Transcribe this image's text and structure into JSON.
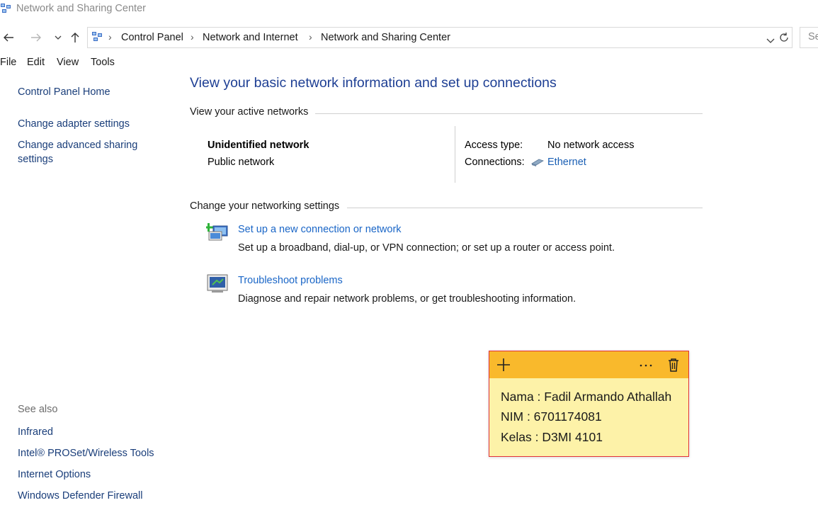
{
  "window": {
    "title": "Network and Sharing Center"
  },
  "nav": {
    "breadcrumb": [
      "Control Panel",
      "Network and Internet",
      "Network and Sharing Center"
    ],
    "search_placeholder": "Se"
  },
  "menu": [
    "File",
    "Edit",
    "View",
    "Tools"
  ],
  "sidebar": {
    "home": "Control Panel Home",
    "links": [
      "Change adapter settings",
      "Change advanced sharing",
      "settings"
    ],
    "see_also_label": "See also",
    "see_also": [
      "Infrared",
      "Intel® PROSet/Wireless Tools",
      "Internet Options",
      "Windows Defender Firewall"
    ]
  },
  "main": {
    "heading": "View your basic network information and set up connections",
    "active_networks_label": "View your active networks",
    "network": {
      "name": "Unidentified network",
      "profile": "Public network",
      "access_type_label": "Access type:",
      "access_type_value": "No network access",
      "connections_label": "Connections:",
      "connections_value": "Ethernet"
    },
    "settings_label": "Change your networking settings",
    "tasks": [
      {
        "title": "Set up a new connection or network",
        "desc": "Set up a broadband, dial-up, or VPN connection; or set up a router or access point."
      },
      {
        "title": "Troubleshoot problems",
        "desc": "Diagnose and repair network problems, or get troubleshooting information."
      }
    ]
  },
  "sticky_note": {
    "lines": [
      "Nama : Fadil Armando Athallah",
      "NIM : 6701174081",
      "Kelas : D3MI 4101"
    ],
    "colors": {
      "header": "#f9b92c",
      "body": "#fdf2a8",
      "border": "#e0303a"
    }
  },
  "colors": {
    "link": "#1a66c7",
    "heading": "#1e3f94"
  }
}
